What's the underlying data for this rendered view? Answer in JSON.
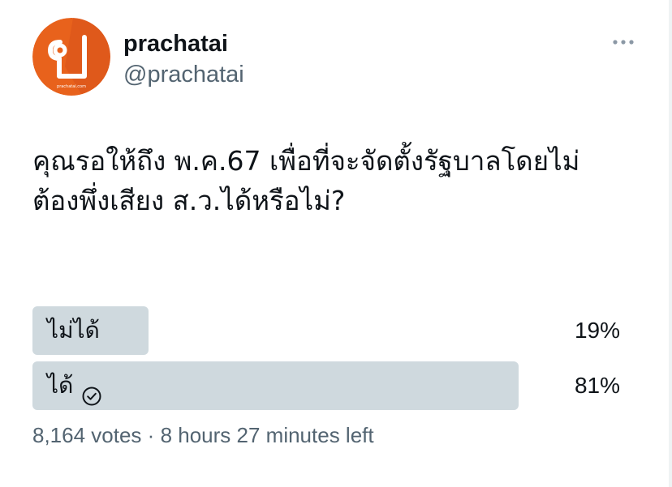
{
  "author": {
    "display_name": "prachatai",
    "handle": "@prachatai",
    "avatar_caption": "prachatai.com",
    "brand_color": "#e8621c"
  },
  "tweet": {
    "text_line1": "คุณรอให้ถึง พ.ค.67 เพื่อที่จะจัดตั้งรัฐบาลโดยไม่",
    "text_line2": "ต้องพึ่งเสียง ส.ว.ได้หรือไม่?"
  },
  "poll": {
    "options": [
      {
        "label": "ไม่ได้",
        "percent_text": "19%",
        "percent": 19,
        "selected": false
      },
      {
        "label": "ได้",
        "percent_text": "81%",
        "percent": 81,
        "selected": true
      }
    ],
    "votes": "8,164 votes",
    "separator": "·",
    "time_left": "8 hours 27 minutes left",
    "bar_color": "#cfd9de"
  },
  "icons": {
    "more": "more-horizontal-icon",
    "selected": "check-circle-icon"
  }
}
